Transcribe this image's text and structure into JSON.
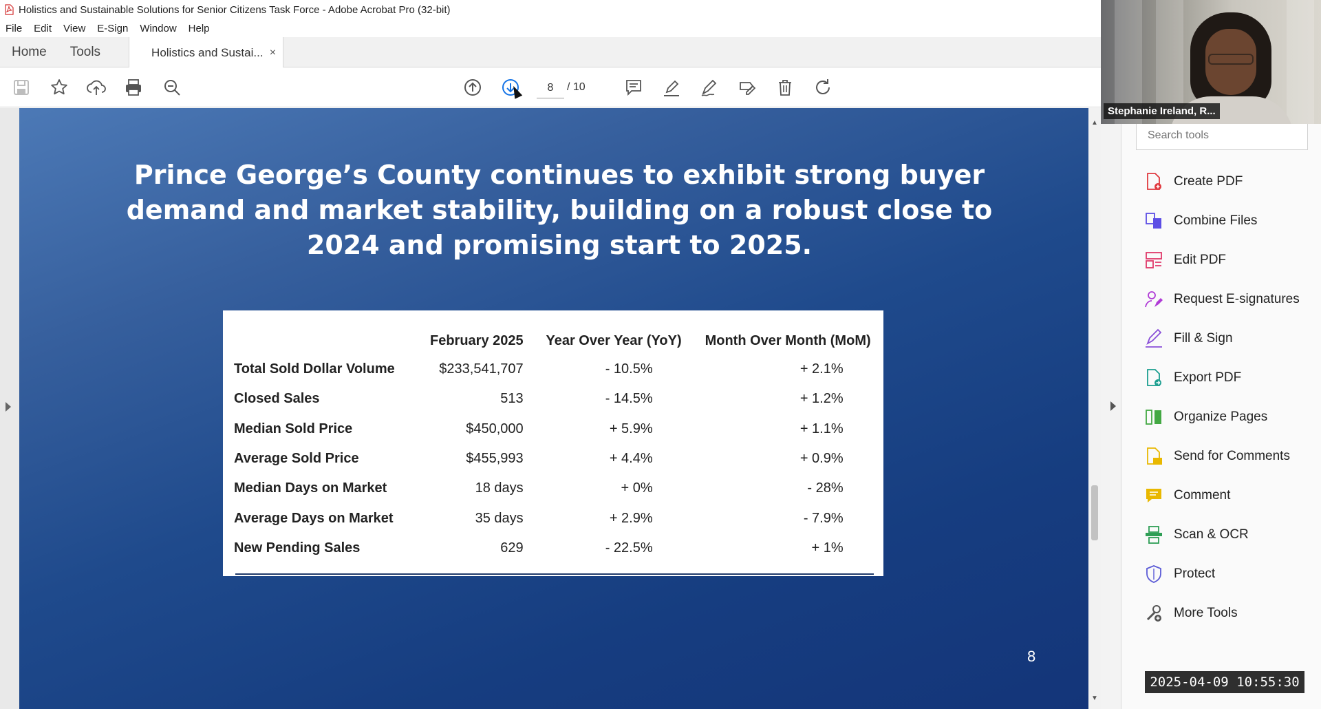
{
  "window": {
    "title": "Holistics and Sustainable Solutions for Senior Citizens Task Force - Adobe Acrobat Pro (32-bit)"
  },
  "menu": [
    "File",
    "Edit",
    "View",
    "E-Sign",
    "Window",
    "Help"
  ],
  "tabs": {
    "home": "Home",
    "tools": "Tools",
    "document": "Holistics and Sustai...",
    "close": "×"
  },
  "toolbar": {
    "icons": [
      "save-icon",
      "bookmark-star-icon",
      "upload-cloud-icon",
      "print-icon",
      "zoom-icon",
      "page-up-icon",
      "page-down-icon",
      "comment-icon",
      "highlight-pen-icon",
      "sign-icon",
      "edit-stamp-icon",
      "delete-icon",
      "rotate-icon"
    ],
    "page_current": "8",
    "page_total": "/ 10"
  },
  "slide": {
    "title": "Prince George’s County continues to exhibit strong buyer demand and market stability, building on a robust close to 2024 and promising start to 2025.",
    "page_number": "8",
    "table": {
      "headers": [
        "",
        "February 2025",
        "Year Over Year (YoY)",
        "Month Over Month (MoM)"
      ],
      "rows": [
        [
          "Total Sold Dollar Volume",
          "$233,541,707",
          "- 10.5%",
          "+ 2.1%"
        ],
        [
          "Closed Sales",
          "513",
          "- 14.5%",
          "+ 1.2%"
        ],
        [
          "Median Sold Price",
          "$450,000",
          "+ 5.9%",
          "+ 1.1%"
        ],
        [
          "Average Sold Price",
          "$455,993",
          "+ 4.4%",
          "+ 0.9%"
        ],
        [
          "Median Days on Market",
          "18 days",
          "+ 0%",
          "- 28%"
        ],
        [
          "Average Days on Market",
          "35 days",
          "+ 2.9%",
          "- 7.9%"
        ],
        [
          "New Pending Sales",
          "629",
          "- 22.5%",
          "+ 1%"
        ]
      ]
    }
  },
  "tools_pane": {
    "search_placeholder": "Search tools",
    "items": [
      {
        "label": "Create PDF",
        "icon": "create-pdf-icon",
        "color": "#e0393e"
      },
      {
        "label": "Combine Files",
        "icon": "combine-files-icon",
        "color": "#5c4ee5"
      },
      {
        "label": "Edit PDF",
        "icon": "edit-pdf-icon",
        "color": "#e0396a"
      },
      {
        "label": "Request E-signatures",
        "icon": "request-esign-icon",
        "color": "#b03bd6"
      },
      {
        "label": "Fill & Sign",
        "icon": "fill-sign-icon",
        "color": "#8a4fd8"
      },
      {
        "label": "Export PDF",
        "icon": "export-pdf-icon",
        "color": "#1b9e8f"
      },
      {
        "label": "Organize Pages",
        "icon": "organize-pages-icon",
        "color": "#43a843"
      },
      {
        "label": "Send for Comments",
        "icon": "send-comments-icon",
        "color": "#e9b800"
      },
      {
        "label": "Comment",
        "icon": "comment-tool-icon",
        "color": "#e9b800"
      },
      {
        "label": "Scan & OCR",
        "icon": "scan-ocr-icon",
        "color": "#2e9e55"
      },
      {
        "label": "Protect",
        "icon": "protect-icon",
        "color": "#5b5bd6"
      },
      {
        "label": "More Tools",
        "icon": "more-tools-icon",
        "color": "#555555"
      }
    ]
  },
  "webcam": {
    "name": "Stephanie Ireland, R..."
  },
  "timestamp": "2025-04-09  10:55:30"
}
